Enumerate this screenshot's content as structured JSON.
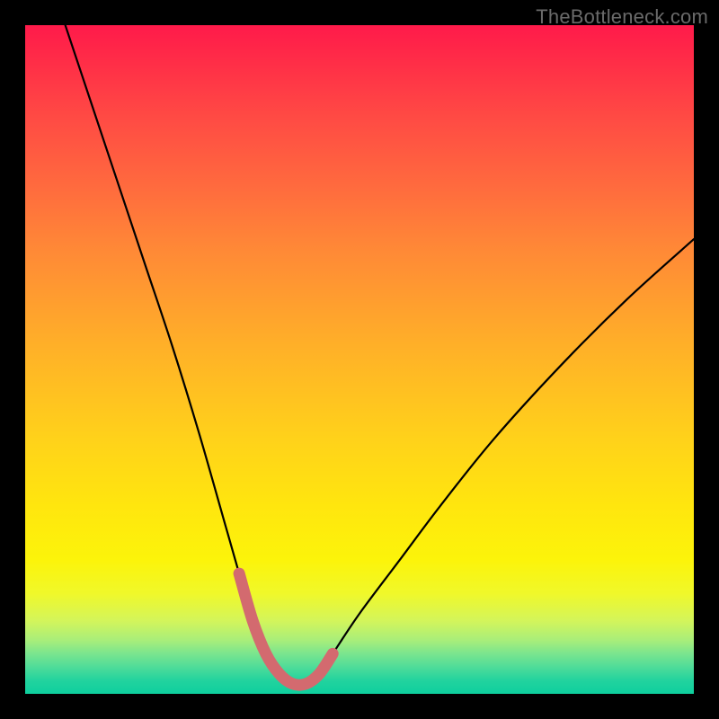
{
  "watermark": "TheBottleneck.com",
  "colors": {
    "background": "#000000",
    "curve_stroke": "#000000",
    "highlight_stroke": "#d36a6f",
    "gradient_top": "#ff1a4a",
    "gradient_bottom": "#0ecf9e"
  },
  "chart_data": {
    "type": "line",
    "title": "",
    "xlabel": "",
    "ylabel": "",
    "xlim": [
      0,
      100
    ],
    "ylim": [
      0,
      100
    ],
    "grid": false,
    "legend": false,
    "series": [
      {
        "name": "bottleneck-curve",
        "x": [
          6,
          10,
          14,
          18,
          22,
          26,
          30,
          32,
          34,
          36,
          38,
          40,
          42,
          44,
          46,
          50,
          56,
          62,
          70,
          80,
          90,
          100
        ],
        "y": [
          100,
          88,
          76,
          64,
          52,
          39,
          25,
          18,
          11,
          6,
          3,
          1.5,
          1.5,
          3,
          6,
          12,
          20,
          28,
          38,
          49,
          59,
          68
        ]
      }
    ],
    "highlight_segment": {
      "name": "optimal-range",
      "x_start": 32,
      "x_end": 46
    },
    "annotations": []
  }
}
